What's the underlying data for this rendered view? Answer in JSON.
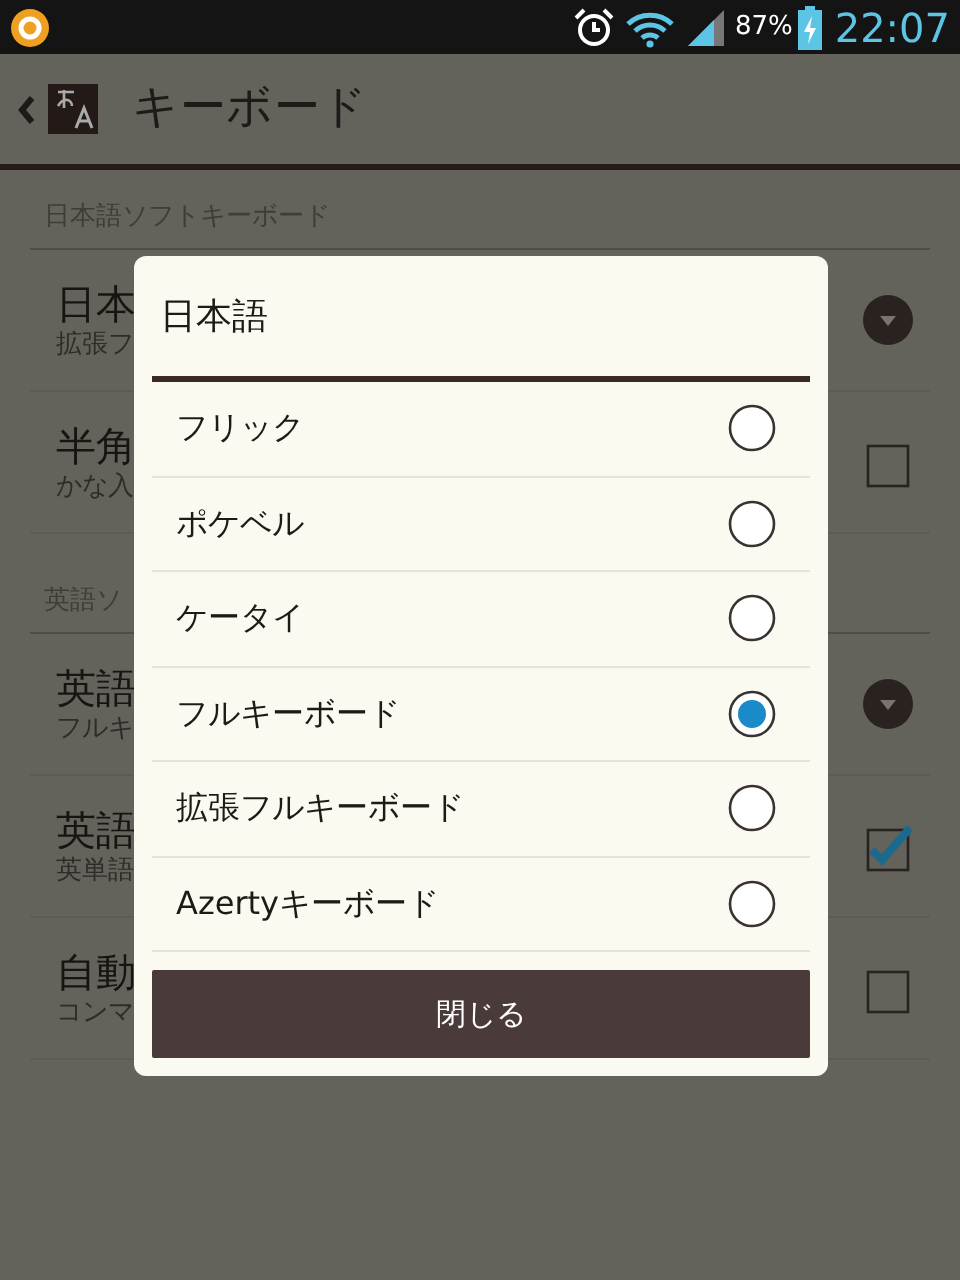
{
  "status_bar": {
    "battery": "87%",
    "time": "22:07"
  },
  "action_bar": {
    "title": "キーボード"
  },
  "settings": [
    {
      "kind": "header",
      "label": "日本語ソフトキーボード"
    },
    {
      "kind": "dropdown",
      "title": "日本",
      "summary": "拡張フ"
    },
    {
      "kind": "checkbox",
      "title": "半角",
      "summary": "かな入",
      "checked": false
    },
    {
      "kind": "header",
      "label": "英語ソ"
    },
    {
      "kind": "dropdown",
      "title": "英語",
      "summary": "フルキ"
    },
    {
      "kind": "checkbox",
      "title": "英語",
      "summary": "英単語",
      "checked": true
    },
    {
      "kind": "checkbox",
      "title": "自動",
      "summary": "コンマ",
      "checked": false
    }
  ],
  "dialog": {
    "title": "日本語",
    "options": [
      {
        "label": "フリック",
        "selected": false
      },
      {
        "label": "ポケベル",
        "selected": false
      },
      {
        "label": "ケータイ",
        "selected": false
      },
      {
        "label": "フルキーボード",
        "selected": true
      },
      {
        "label": "拡張フルキーボード",
        "selected": false
      },
      {
        "label": "Azertyキーボード",
        "selected": false
      }
    ],
    "button": "閉じる"
  }
}
